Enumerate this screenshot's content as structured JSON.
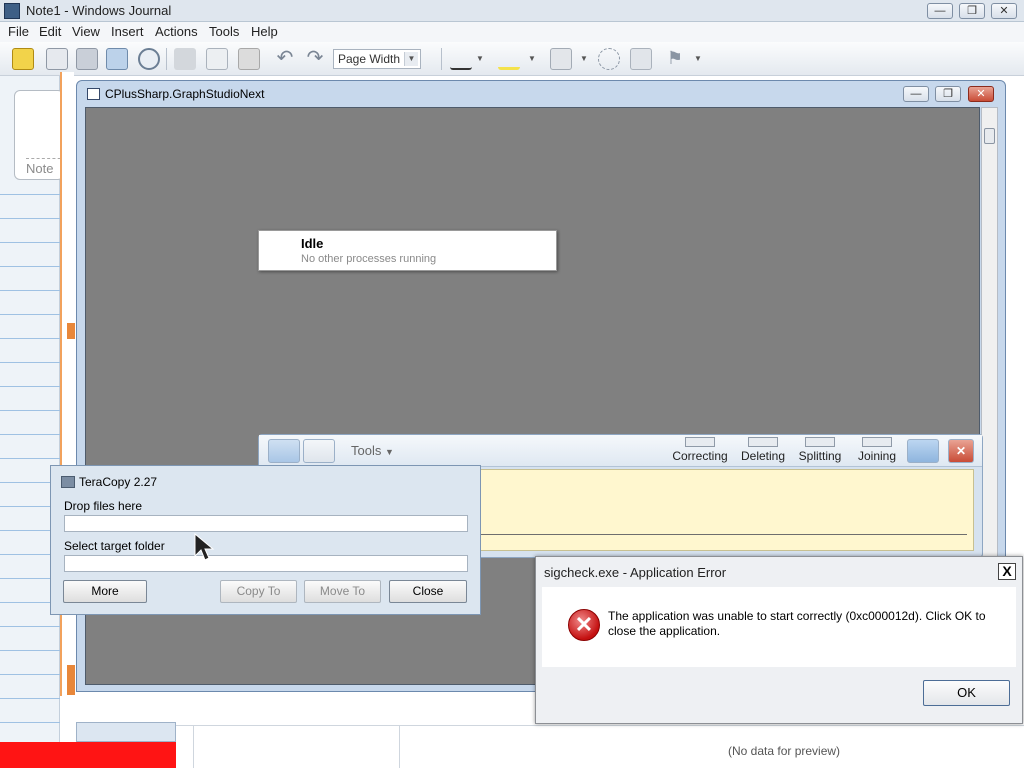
{
  "journal": {
    "title": "Note1 - Windows Journal",
    "menu": [
      "File",
      "Edit",
      "View",
      "Insert",
      "Actions",
      "Tools",
      "Help"
    ],
    "zoom_value": "Page Width",
    "note_label": "Note",
    "preview_text": "(No data for preview)"
  },
  "graphstudio": {
    "title": "CPlusSharp.GraphStudioNext",
    "idle_title": "Idle",
    "idle_subtitle": "No other processes running"
  },
  "input_panel": {
    "tools_label": "Tools",
    "actions": [
      "Correcting",
      "Deleting",
      "Splitting",
      "Joining"
    ]
  },
  "teracopy": {
    "title": "TeraCopy 2.27",
    "drop_label": "Drop files here",
    "target_label": "Select target folder",
    "buttons": {
      "more": "More",
      "copy_to": "Copy To",
      "move_to": "Move To",
      "close": "Close"
    }
  },
  "error_dialog": {
    "title": "sigcheck.exe - Application Error",
    "message": "The application was unable to start correctly (0xc000012d). Click OK to close the application.",
    "ok_label": "OK",
    "close_glyph": "X"
  },
  "colors": {
    "workspace_gray": "#808080",
    "error_red": "#c41010",
    "input_yellow": "#fff7cf",
    "journal_orange": "#e8873a"
  }
}
